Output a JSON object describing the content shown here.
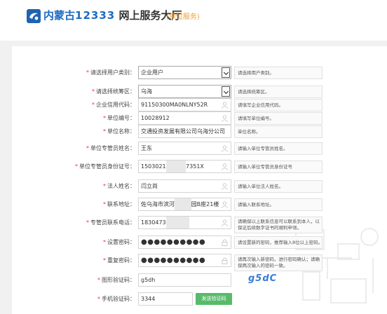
{
  "header": {
    "brand_name": "内蒙古",
    "brand_number": "12333",
    "brand_title": "网上服务大厅",
    "brand_sub": "(单位服务)"
  },
  "form": {
    "user_type": {
      "label": "请选择用户类别：",
      "value": "企业用户",
      "hint": "请选择用户类别。"
    },
    "district": {
      "label": "请选择统筹区：",
      "value": "乌海",
      "hint": "请选择统筹区。"
    },
    "credit_code": {
      "label": "企业信用代码：",
      "value": "91150300MA0NLNY52R",
      "hint": "请填写企业信用代码。"
    },
    "unit_number": {
      "label": "单位编号：",
      "value": "10028912",
      "hint": "请填写单位编号。"
    },
    "unit_name": {
      "label": "单位名称：",
      "value": "交通投资发展有限公司乌海分公司",
      "hint": "单位名称。"
    },
    "admin_name": {
      "label": "单位专管员姓名：",
      "value": "王东",
      "hint": "请输入单位专管员姓名。"
    },
    "admin_id": {
      "label": "单位专管员身份证号：",
      "value_prefix": "1503021",
      "value_suffix": "7351X",
      "hint": "请输入单位专管员身份证号"
    },
    "legal_name": {
      "label": "法人姓名：",
      "value": "闫立尚",
      "hint": "请输入单位法人姓名。"
    },
    "address": {
      "label": "联系地址：",
      "value_prefix": "佐乌海市滨河",
      "value_suffix": "园B座21楼",
      "hint": "请输入联系地址。"
    },
    "admin_phone": {
      "label": "专管员联系电话：",
      "value_prefix": "1830473",
      "hint": "请确保以上联系信息可以联系到本人，以保证后续数字证书的顺利申领。"
    },
    "password": {
      "label": "设置密码：",
      "value": "●●●●●●●●●●",
      "hint": "请设置新的密码，推荐输入8位以上密码。"
    },
    "confirm_password": {
      "label": "重复密码：",
      "value": "●●●●●●●●●●",
      "hint": "请再次输入新密码，进行密码确认；请确保两次输入的密码一致。"
    },
    "captcha": {
      "label": "图形验证码：",
      "value": "g5dh",
      "image_text": "g5dC"
    },
    "sms_code": {
      "label": "手机验证码：",
      "value": "3344",
      "button": "发送验证码"
    }
  }
}
